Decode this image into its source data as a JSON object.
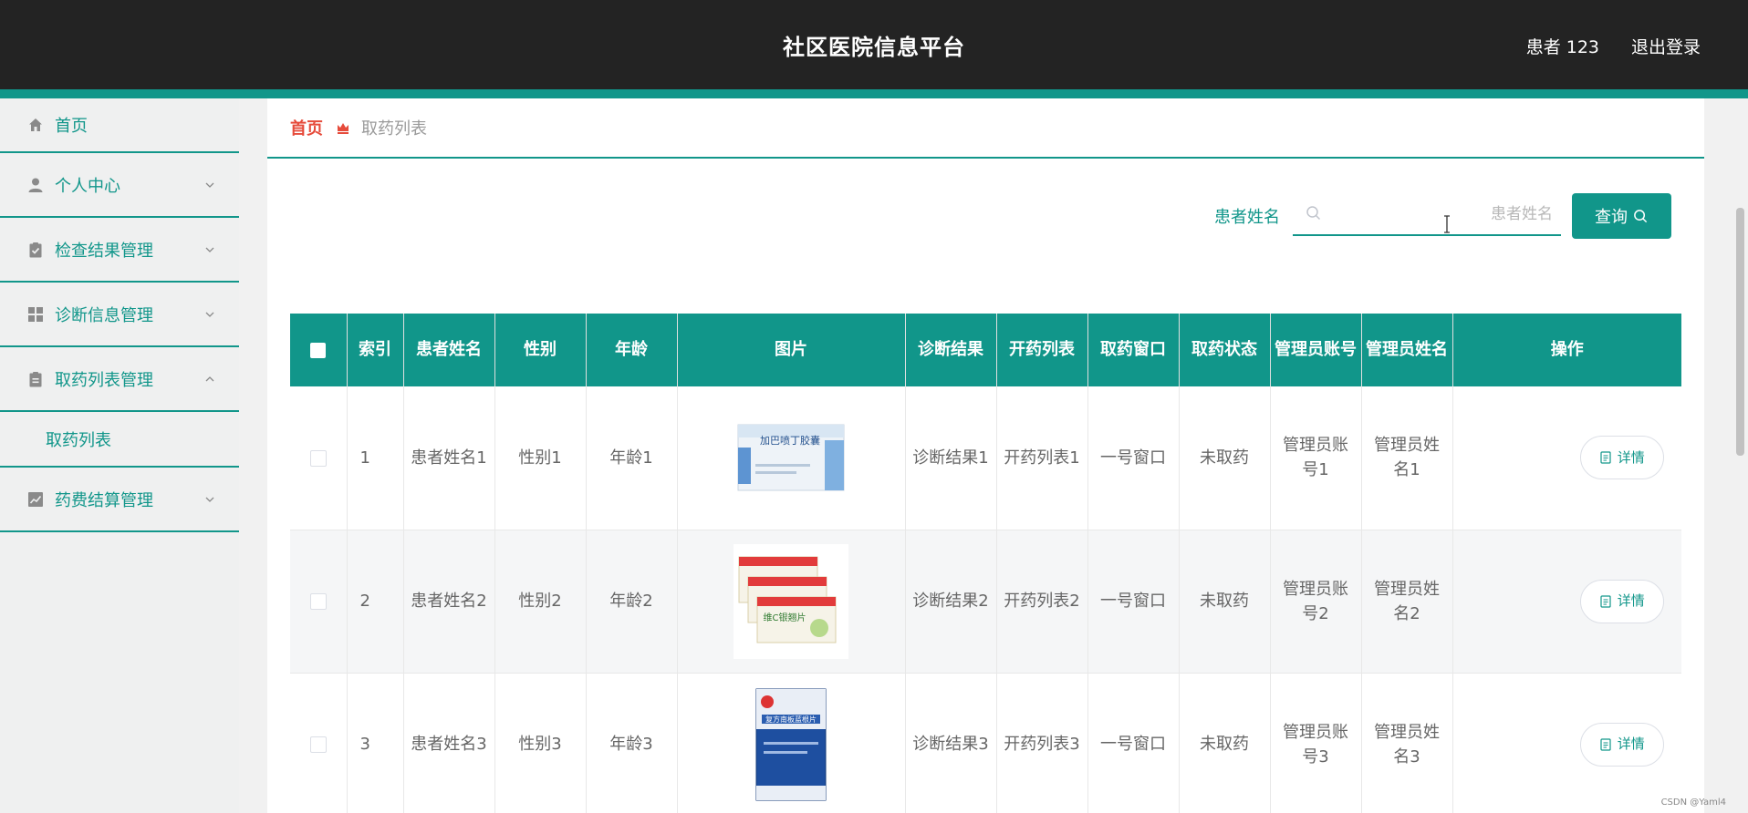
{
  "header": {
    "title": "社区医院信息平台",
    "user": "患者 123",
    "logout": "退出登录"
  },
  "sidebar": {
    "items": [
      {
        "label": "首页",
        "icon": "home-icon"
      },
      {
        "label": "个人中心",
        "icon": "user-icon",
        "expanded": false
      },
      {
        "label": "检查结果管理",
        "icon": "clipboard-check-icon",
        "expanded": false
      },
      {
        "label": "诊断信息管理",
        "icon": "grid-icon",
        "expanded": false
      },
      {
        "label": "取药列表管理",
        "icon": "clipboard-icon",
        "expanded": true
      },
      {
        "label": "药费结算管理",
        "icon": "chart-icon",
        "expanded": false
      }
    ],
    "submenu": {
      "label": "取药列表"
    }
  },
  "breadcrumb": {
    "home": "首页",
    "current": "取药列表"
  },
  "search": {
    "label": "患者姓名",
    "placeholder": "患者姓名",
    "value": "",
    "button": "查询"
  },
  "table": {
    "headers": [
      "索引",
      "患者姓名",
      "性别",
      "年龄",
      "图片",
      "诊断结果",
      "开药列表",
      "取药窗口",
      "取药状态",
      "管理员账号",
      "管理员姓名",
      "操作"
    ],
    "rows": [
      {
        "index": "1",
        "name": "患者姓名1",
        "gender": "性别1",
        "age": "年龄1",
        "image": {
          "type": "capsule-box",
          "text": "加巴喷丁胶囊",
          "color": "#3a7bd5"
        },
        "diagnosis": "诊断结果1",
        "prescription": "开药列表1",
        "window": "一号窗口",
        "status": "未取药",
        "admin_account": "管理员账号1",
        "admin_name": "管理员姓名1",
        "action": "详情"
      },
      {
        "index": "2",
        "name": "患者姓名2",
        "gender": "性别2",
        "age": "年龄2",
        "image": {
          "type": "tablet-boxes",
          "text": "维C银翘片",
          "color": "#e23b3b"
        },
        "diagnosis": "诊断结果2",
        "prescription": "开药列表2",
        "window": "一号窗口",
        "status": "未取药",
        "admin_account": "管理员账号2",
        "admin_name": "管理员姓名2",
        "action": "详情"
      },
      {
        "index": "3",
        "name": "患者姓名3",
        "gender": "性别3",
        "age": "年龄3",
        "image": {
          "type": "tablet-box",
          "text": "复方南板蓝根片",
          "color": "#1e4fa0"
        },
        "diagnosis": "诊断结果3",
        "prescription": "开药列表3",
        "window": "一号窗口",
        "status": "未取药",
        "admin_account": "管理员账号3",
        "admin_name": "管理员姓名3",
        "action": "详情"
      }
    ]
  },
  "watermark": "CSDN @Yaml4",
  "colors": {
    "primary": "#11968a",
    "header_bg": "#232323",
    "breadcrumb_home": "#e64b3b"
  }
}
